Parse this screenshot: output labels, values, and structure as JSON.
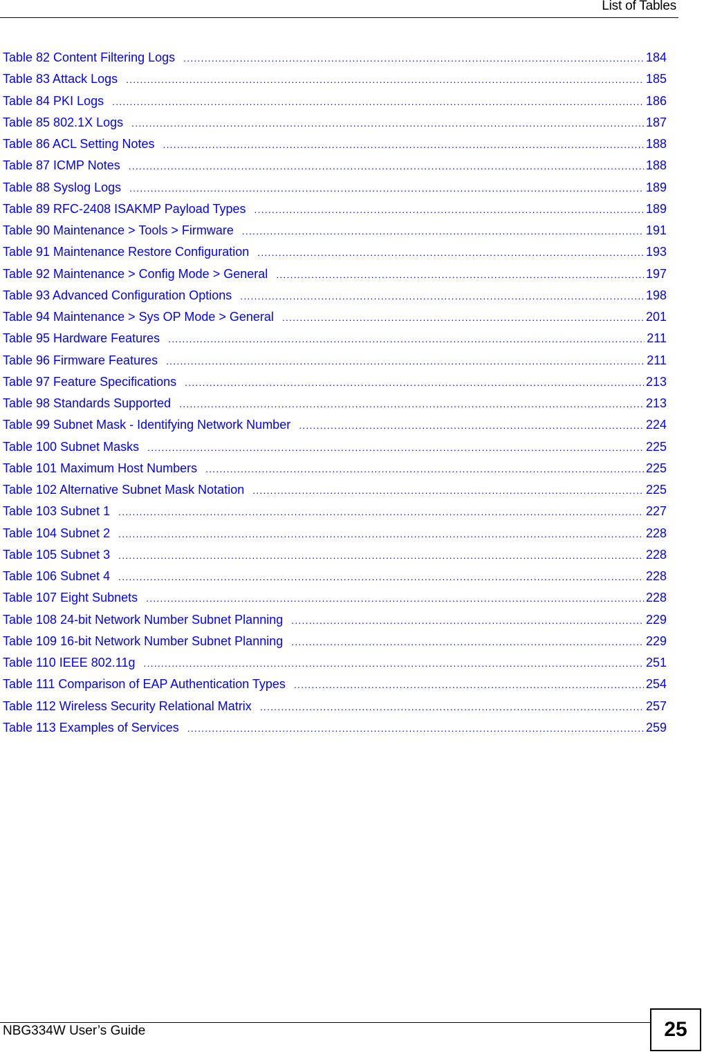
{
  "header": {
    "title": "List of Tables"
  },
  "footer": {
    "guide_title": "NBG334W User’s Guide",
    "page_number": "25"
  },
  "colors": {
    "link": "#0000ff",
    "text": "#000000"
  },
  "toc": {
    "entries": [
      {
        "label": "Table 82 Content Filtering Logs",
        "page": "184"
      },
      {
        "label": "Table 83 Attack Logs",
        "page": "185"
      },
      {
        "label": "Table 84 PKI Logs",
        "page": "186"
      },
      {
        "label": "Table 85 802.1X Logs",
        "page": "187"
      },
      {
        "label": "Table 86 ACL Setting Notes",
        "page": "188"
      },
      {
        "label": "Table 87 ICMP Notes",
        "page": "188"
      },
      {
        "label": "Table 88 Syslog Logs",
        "page": "189"
      },
      {
        "label": "Table 89 RFC-2408 ISAKMP Payload Types",
        "page": "189"
      },
      {
        "label": "Table 90 Maintenance > Tools > Firmware",
        "page": "191"
      },
      {
        "label": "Table 91 Maintenance Restore Configuration",
        "page": "193"
      },
      {
        "label": "Table 92 Maintenance > Config Mode > General",
        "page": "197"
      },
      {
        "label": "Table 93 Advanced Configuration Options",
        "page": "198"
      },
      {
        "label": "Table 94 Maintenance > Sys OP Mode > General",
        "page": "201"
      },
      {
        "label": "Table 95 Hardware Features",
        "page": "211"
      },
      {
        "label": "Table 96 Firmware Features",
        "page": "211"
      },
      {
        "label": "Table 97 Feature Specifications",
        "page": "213"
      },
      {
        "label": "Table 98 Standards Supported",
        "page": "213"
      },
      {
        "label": "Table 99 Subnet Mask - Identifying Network Number",
        "page": "224"
      },
      {
        "label": "Table 100 Subnet Masks",
        "page": "225"
      },
      {
        "label": "Table 101 Maximum Host Numbers",
        "page": "225"
      },
      {
        "label": "Table 102 Alternative Subnet Mask Notation",
        "page": "225"
      },
      {
        "label": "Table 103 Subnet 1",
        "page": "227"
      },
      {
        "label": "Table 104 Subnet 2",
        "page": "228"
      },
      {
        "label": "Table 105 Subnet 3",
        "page": "228"
      },
      {
        "label": "Table 106 Subnet 4",
        "page": "228"
      },
      {
        "label": "Table 107 Eight Subnets",
        "page": "228"
      },
      {
        "label": "Table 108 24-bit Network Number Subnet Planning",
        "page": "229"
      },
      {
        "label": "Table 109 16-bit Network Number Subnet Planning",
        "page": "229"
      },
      {
        "label": "Table 110 IEEE 802.11g",
        "page": "251"
      },
      {
        "label": "Table 111 Comparison of EAP Authentication Types",
        "page": "254"
      },
      {
        "label": "Table 112 Wireless Security Relational Matrix",
        "page": "257"
      },
      {
        "label": "Table 113 Examples of Services",
        "page": "259"
      }
    ]
  }
}
